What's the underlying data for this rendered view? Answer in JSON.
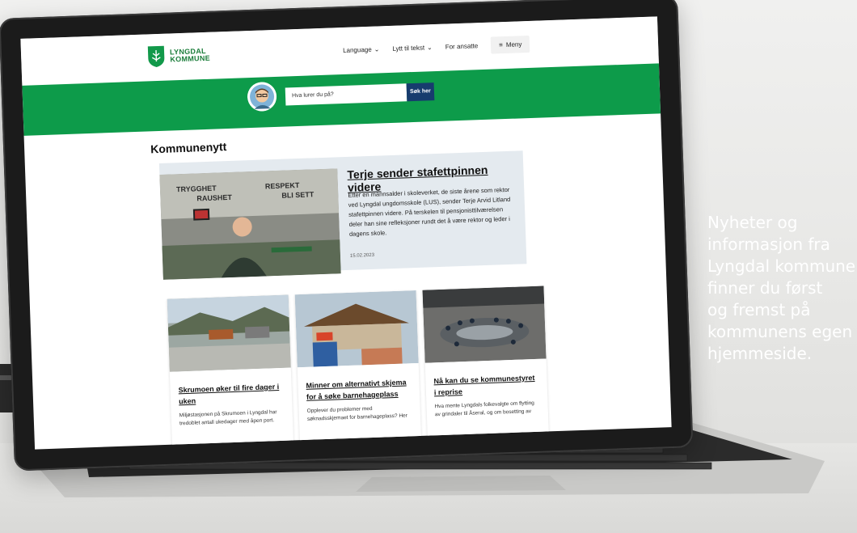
{
  "header": {
    "logo_line1": "LYNGDAL",
    "logo_line2": "KOMMUNE",
    "nav_language": "Language",
    "nav_listen": "Lytt til tekst",
    "nav_employees": "For ansatte",
    "menu_label": "Meny",
    "chevron": "⌄",
    "hamburger": "≡"
  },
  "search": {
    "placeholder": "Hva lurer du på?",
    "button_label": "Søk her"
  },
  "page": {
    "title": "Kommunenytt"
  },
  "featured": {
    "title": "Terje sender stafettpinnen videre",
    "text": "Etter en mannsalder i skoleverket, de siste årene som rektor ved Lyngdal ungdomsskole (LUS), sender Terje Arvid Litland stafettpinnen videre. På terskelen til pensjonisttilværelsen deler han sine refleksjoner rundt det å være rektor og leder i dagens skole.",
    "date": "15.02.2023",
    "wall_text_1": "TRYGGHET",
    "wall_text_2": "RAUSHET",
    "wall_text_3": "RESPEKT",
    "wall_text_4": "BLI SETT"
  },
  "cards": [
    {
      "title": "Skrumoen øker til fire dager i uken",
      "text": "Miljøstasjonen på Skrumoen i Lyngdal har tredoblet antall ukedager med åpen port."
    },
    {
      "title": "Minner om alternativt skjema for å søke barnehageplass",
      "text": "Opplever du problemer med søknadsskjemaet for barnehageplass? Her"
    },
    {
      "title": "Nå kan du se kommunestyret i reprise",
      "text": "Hva mente Lyngdals folkevalgte om flytting av grindaler til Åseral, og om bosetting av"
    }
  ],
  "side_caption": {
    "line1": "Nyheter og",
    "line2": "informasjon fra",
    "line3": "Lyngdal kommune",
    "line4": "finner du først",
    "line5": "og fremst på",
    "line6": "kommunens egen",
    "line7": "hjemmeside."
  },
  "colors": {
    "brand_green": "#0d9b4a",
    "search_button": "#173c6e",
    "featured_bg": "#e4eaef"
  }
}
